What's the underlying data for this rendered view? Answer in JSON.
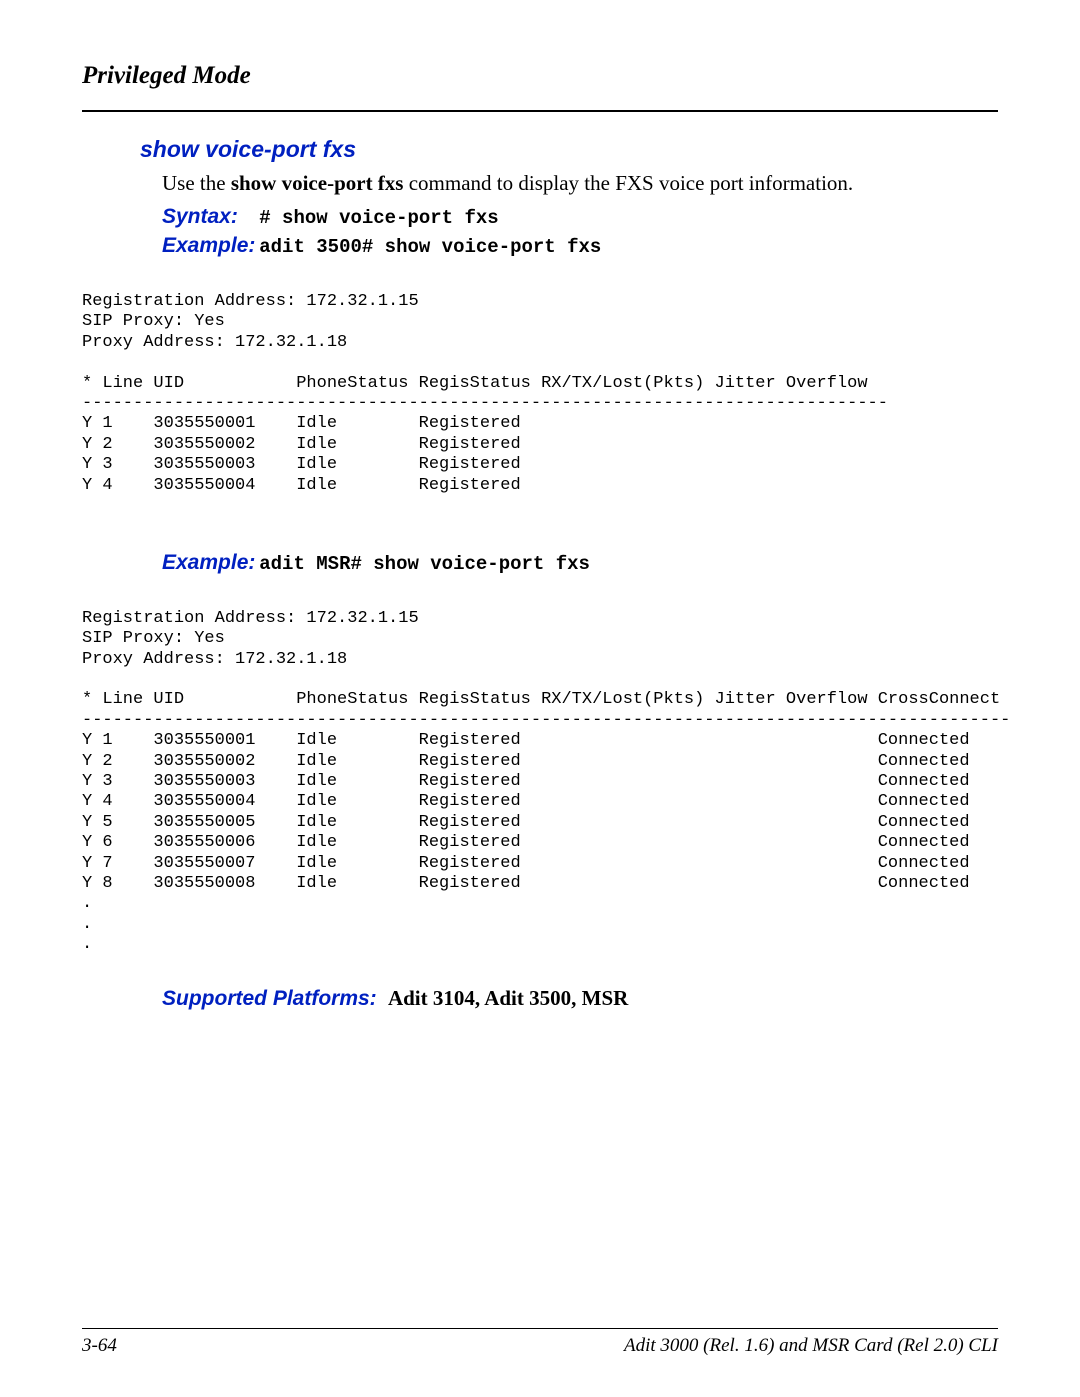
{
  "header": {
    "mode": "Privileged Mode"
  },
  "section": {
    "title": "show voice-port fxs",
    "desc_pre": "Use the ",
    "desc_cmd": "show voice-port fxs",
    "desc_post": " command to display the FXS voice port information.",
    "syntax_label": "Syntax:",
    "syntax_value": "# show voice-port fxs",
    "example_label": "Example:",
    "example1_value": "adit 3500# show voice-port fxs",
    "example2_value": "adit MSR# show voice-port fxs",
    "supported_label": "Supported Platforms:",
    "supported_value": "Adit 3104, Adit 3500, MSR"
  },
  "output1": "Registration Address: 172.32.1.15\nSIP Proxy: Yes\nProxy Address: 172.32.1.18\n\n* Line UID           PhoneStatus RegisStatus RX/TX/Lost(Pkts) Jitter Overflow\n-------------------------------------------------------------------------------\nY 1    3035550001    Idle        Registered\nY 2    3035550002    Idle        Registered\nY 3    3035550003    Idle        Registered\nY 4    3035550004    Idle        Registered",
  "output2": "Registration Address: 172.32.1.15\nSIP Proxy: Yes\nProxy Address: 172.32.1.18\n\n* Line UID           PhoneStatus RegisStatus RX/TX/Lost(Pkts) Jitter Overflow CrossConnect\n-------------------------------------------------------------------------------------------\nY 1    3035550001    Idle        Registered                                   Connected\nY 2    3035550002    Idle        Registered                                   Connected\nY 3    3035550003    Idle        Registered                                   Connected\nY 4    3035550004    Idle        Registered                                   Connected\nY 5    3035550005    Idle        Registered                                   Connected\nY 6    3035550006    Idle        Registered                                   Connected\nY 7    3035550007    Idle        Registered                                   Connected\nY 8    3035550008    Idle        Registered                                   Connected\n.\n.\n.",
  "footer": {
    "page": "3-64",
    "doc": "Adit 3000 (Rel. 1.6) and MSR Card (Rel 2.0) CLI"
  }
}
